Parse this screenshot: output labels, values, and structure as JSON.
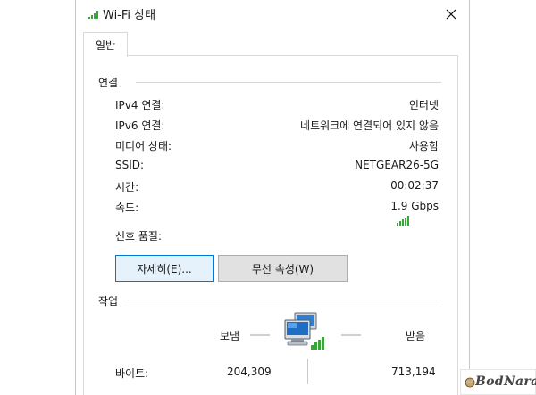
{
  "window": {
    "title": "Wi-Fi 상태"
  },
  "tabs": [
    {
      "label": "일반"
    }
  ],
  "connection": {
    "title": "연결",
    "rows": [
      {
        "label": "IPv4 연결:",
        "value": "인터넷"
      },
      {
        "label": "IPv6 연결:",
        "value": "네트워크에 연결되어 있지 않음"
      },
      {
        "label": "미디어 상태:",
        "value": "사용함"
      },
      {
        "label": "SSID:",
        "value": "NETGEAR26-5G"
      },
      {
        "label": "시간:",
        "value": "00:02:37"
      },
      {
        "label": "속도:",
        "value": "1.9 Gbps"
      }
    ],
    "signal_label": "신호 품질:",
    "signal_bars_active": 5,
    "signal_bars_total": 5
  },
  "buttons": {
    "details": "자세히(E)...",
    "wireless_properties": "무선 속성(W)"
  },
  "activity": {
    "title": "작업",
    "sent_label": "보냄",
    "received_label": "받음",
    "bytes_label": "바이트:",
    "sent_bytes": "204,309",
    "received_bytes": "713,194"
  },
  "icons": {
    "title": "signal-icon",
    "close": "close-icon",
    "signal": "signal-bars-icon",
    "network": "network-computers-icon"
  },
  "colors": {
    "accent": "#0078d7",
    "signal_green": "#3aa43a"
  },
  "watermark": {
    "text": "BodNara"
  }
}
